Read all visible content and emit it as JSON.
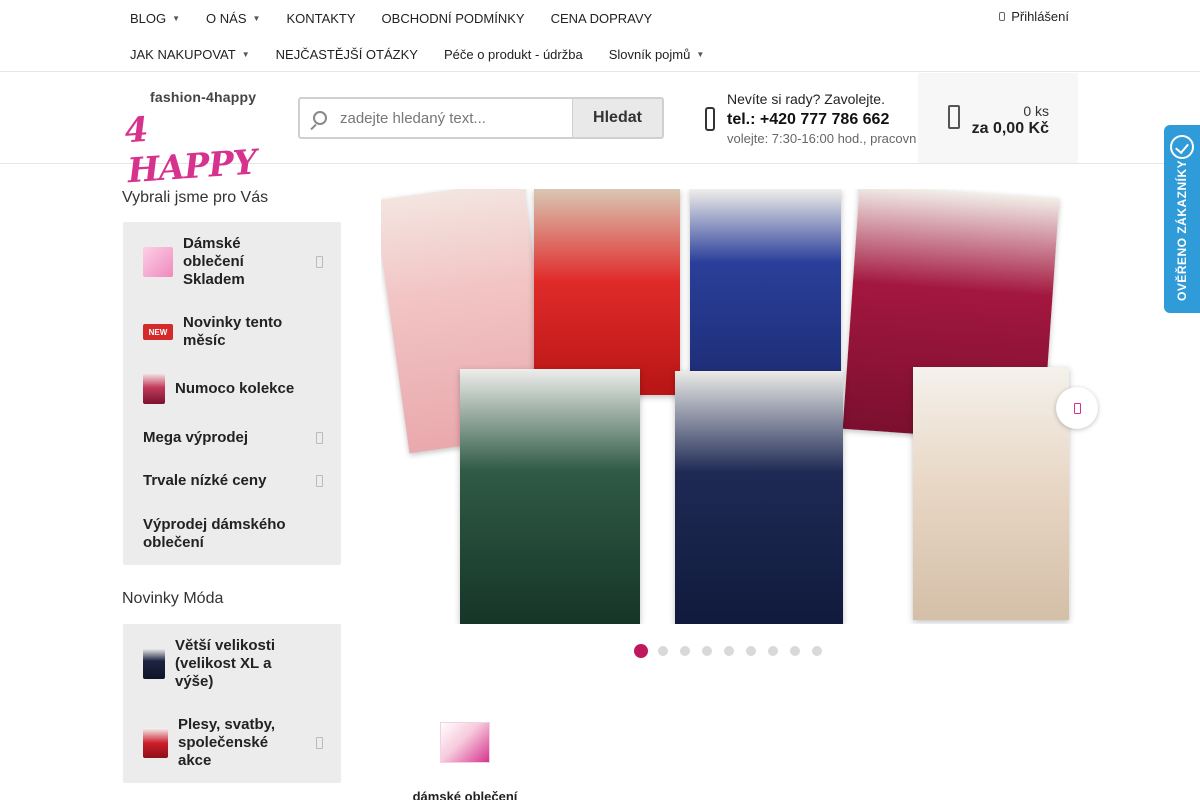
{
  "nav": {
    "row1": [
      {
        "label": "BLOG",
        "dropdown": true
      },
      {
        "label": "O NÁS",
        "dropdown": true
      },
      {
        "label": "KONTAKTY",
        "dropdown": false
      },
      {
        "label": "OBCHODNÍ PODMÍNKY",
        "dropdown": false
      },
      {
        "label": "CENA DOPRAVY",
        "dropdown": false
      }
    ],
    "row2": [
      {
        "label": "JAK NAKUPOVAT",
        "dropdown": true
      },
      {
        "label": "NEJČASTĚJŠÍ OTÁZKY",
        "dropdown": false
      },
      {
        "label": "Péče o produkt - údržba",
        "dropdown": false
      },
      {
        "label": "Slovník pojmů",
        "dropdown": true
      }
    ],
    "login": "Přihlášení"
  },
  "logo": {
    "top": "fashion-4happy",
    "main": "4 HAPPY"
  },
  "search": {
    "placeholder": "zadejte hledaný text...",
    "button": "Hledat"
  },
  "contact": {
    "line1": "Nevíte si rady? Zavolejte.",
    "phone": "tel.: +420 777 786 662",
    "hours": "volejte: 7:30-16:00 hod., pracovn"
  },
  "cart": {
    "count": "0 ks",
    "total": "za 0,00 Kč"
  },
  "sidebar": {
    "section1_title": "Vybrali jsme pro Vás",
    "section1": [
      {
        "label": "Dámské oblečení Skladem",
        "icon": "pink-banner-thumb",
        "arrow": true
      },
      {
        "label": "Novinky tento měsíc",
        "icon": "new-badge-thumb",
        "arrow": false
      },
      {
        "label": "Numoco kolekce",
        "icon": "dress-thumb",
        "arrow": false
      },
      {
        "label": "Mega výprodej",
        "icon": "",
        "arrow": true
      },
      {
        "label": "Trvale nízké ceny",
        "icon": "",
        "arrow": true
      },
      {
        "label": "Výprodej dámského oblečení",
        "icon": "",
        "arrow": false
      }
    ],
    "section2_title": "Novinky Móda",
    "section2": [
      {
        "label": "Větší velikosti (velikost XL a výše)",
        "icon": "navy-dress-thumb",
        "arrow": false
      },
      {
        "label": "Plesy, svatby, společenské akce",
        "icon": "red-dress-thumb",
        "arrow": true
      }
    ]
  },
  "carousel": {
    "slides": 9,
    "active": 1
  },
  "categories": [
    {
      "label": "dámské oblečení"
    }
  ],
  "verified_badge": {
    "text": "OVĚŘENO ZÁKAZNÍKY"
  },
  "colors": {
    "accent": "#c0185d",
    "logo": "#d6338f",
    "badge": "#2f9bd8",
    "sidebar_bg": "#ececec"
  }
}
